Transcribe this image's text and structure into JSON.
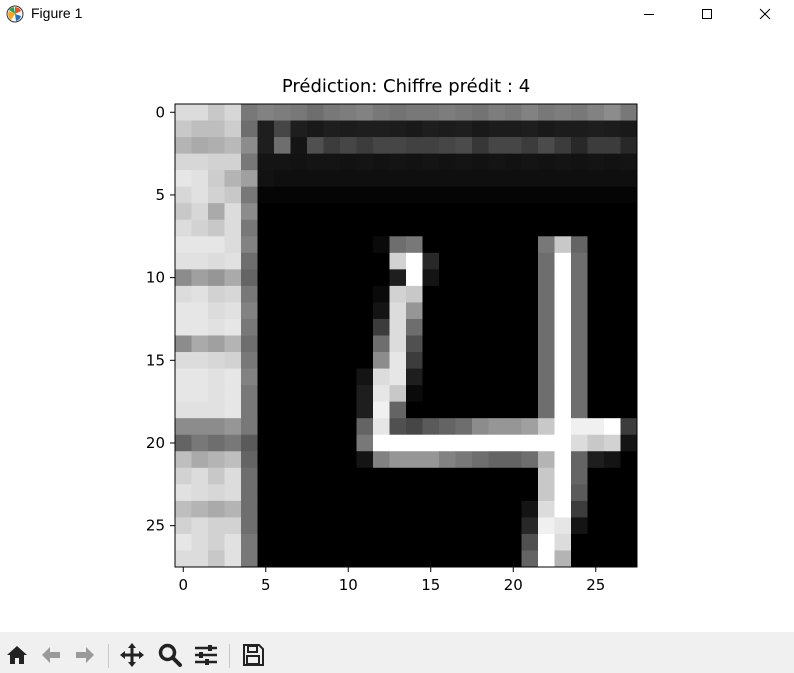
{
  "window": {
    "title": "Figure 1",
    "controls": [
      "minimize",
      "maximize",
      "close"
    ]
  },
  "toolbar": {
    "buttons": [
      "home-icon",
      "back-arrow-icon",
      "forward-arrow-icon",
      "pan-icon",
      "zoom-icon",
      "configure-subplots-icon",
      "save-icon"
    ]
  },
  "chart_data": {
    "type": "heatmap",
    "title": "Prédiction: Chiffre prédit : 4",
    "colormap": "gray",
    "xlabel": "",
    "ylabel": "",
    "xlim": [
      -0.5,
      27.5
    ],
    "ylim": [
      27.5,
      -0.5
    ],
    "xticks": [
      0,
      5,
      10,
      15,
      20,
      25
    ],
    "yticks": [
      0,
      5,
      10,
      15,
      20,
      25
    ],
    "grid": false,
    "shape": [
      28,
      28
    ],
    "values": [
      [
        220,
        220,
        200,
        215,
        120,
        130,
        125,
        120,
        110,
        120,
        125,
        130,
        120,
        115,
        120,
        120,
        125,
        120,
        115,
        125,
        120,
        130,
        120,
        125,
        120,
        130,
        140,
        120
      ],
      [
        200,
        190,
        190,
        205,
        110,
        30,
        70,
        30,
        25,
        30,
        28,
        30,
        30,
        28,
        25,
        30,
        28,
        30,
        25,
        28,
        28,
        30,
        25,
        28,
        28,
        30,
        28,
        25
      ],
      [
        180,
        170,
        175,
        185,
        140,
        30,
        110,
        20,
        80,
        60,
        70,
        60,
        70,
        70,
        65,
        65,
        70,
        75,
        55,
        70,
        70,
        60,
        75,
        60,
        40,
        60,
        60,
        40
      ],
      [
        215,
        215,
        210,
        210,
        120,
        20,
        20,
        18,
        20,
        20,
        18,
        20,
        18,
        20,
        18,
        20,
        18,
        20,
        18,
        20,
        18,
        20,
        18,
        20,
        18,
        20,
        18,
        20
      ],
      [
        230,
        225,
        205,
        180,
        160,
        18,
        15,
        15,
        15,
        15,
        15,
        15,
        15,
        15,
        15,
        15,
        15,
        15,
        15,
        15,
        15,
        15,
        15,
        15,
        15,
        15,
        15,
        15
      ],
      [
        215,
        225,
        210,
        200,
        120,
        5,
        5,
        5,
        5,
        5,
        5,
        5,
        5,
        5,
        5,
        5,
        5,
        5,
        5,
        5,
        5,
        5,
        5,
        5,
        5,
        5,
        5,
        5
      ],
      [
        200,
        215,
        170,
        220,
        140,
        0,
        0,
        0,
        0,
        0,
        0,
        0,
        0,
        0,
        0,
        0,
        0,
        0,
        0,
        0,
        0,
        0,
        0,
        0,
        0,
        0,
        0,
        0
      ],
      [
        220,
        210,
        200,
        220,
        120,
        0,
        0,
        0,
        0,
        0,
        0,
        0,
        0,
        0,
        0,
        0,
        0,
        0,
        0,
        0,
        0,
        0,
        0,
        0,
        0,
        0,
        0,
        0
      ],
      [
        230,
        230,
        230,
        220,
        130,
        0,
        0,
        0,
        0,
        0,
        0,
        0,
        10,
        110,
        120,
        0,
        0,
        0,
        0,
        0,
        0,
        0,
        120,
        200,
        100,
        0,
        0,
        0
      ],
      [
        225,
        225,
        220,
        225,
        110,
        0,
        0,
        0,
        0,
        0,
        0,
        0,
        0,
        210,
        255,
        40,
        0,
        0,
        0,
        0,
        0,
        0,
        110,
        255,
        110,
        0,
        0,
        0
      ],
      [
        140,
        160,
        150,
        170,
        100,
        0,
        0,
        0,
        0,
        0,
        0,
        0,
        0,
        30,
        255,
        20,
        0,
        0,
        0,
        0,
        0,
        0,
        110,
        255,
        110,
        0,
        0,
        0
      ],
      [
        220,
        225,
        210,
        215,
        120,
        0,
        0,
        0,
        0,
        0,
        0,
        0,
        10,
        210,
        200,
        0,
        0,
        0,
        0,
        0,
        0,
        0,
        110,
        255,
        110,
        0,
        0,
        0
      ],
      [
        230,
        230,
        220,
        225,
        130,
        0,
        0,
        0,
        0,
        0,
        0,
        0,
        20,
        220,
        150,
        0,
        0,
        0,
        0,
        0,
        0,
        0,
        110,
        255,
        110,
        0,
        0,
        0
      ],
      [
        230,
        230,
        225,
        230,
        120,
        0,
        0,
        0,
        0,
        0,
        0,
        0,
        60,
        220,
        110,
        0,
        0,
        0,
        0,
        0,
        0,
        0,
        110,
        255,
        110,
        0,
        0,
        0
      ],
      [
        140,
        170,
        160,
        180,
        110,
        0,
        0,
        0,
        0,
        0,
        0,
        0,
        110,
        220,
        80,
        0,
        0,
        0,
        0,
        0,
        0,
        0,
        110,
        255,
        110,
        0,
        0,
        0
      ],
      [
        220,
        220,
        215,
        210,
        120,
        0,
        0,
        0,
        0,
        0,
        0,
        0,
        140,
        230,
        60,
        0,
        0,
        0,
        0,
        0,
        0,
        0,
        110,
        255,
        110,
        0,
        0,
        0
      ],
      [
        230,
        230,
        225,
        230,
        130,
        0,
        0,
        0,
        0,
        0,
        0,
        20,
        220,
        230,
        30,
        0,
        0,
        0,
        0,
        0,
        0,
        0,
        110,
        255,
        110,
        0,
        0,
        0
      ],
      [
        230,
        230,
        225,
        230,
        120,
        0,
        0,
        0,
        0,
        0,
        0,
        30,
        230,
        200,
        10,
        0,
        0,
        0,
        0,
        0,
        0,
        0,
        110,
        255,
        110,
        0,
        0,
        0
      ],
      [
        225,
        225,
        225,
        230,
        120,
        0,
        0,
        0,
        0,
        0,
        0,
        30,
        240,
        100,
        0,
        0,
        0,
        0,
        0,
        0,
        0,
        0,
        110,
        255,
        110,
        0,
        0,
        0
      ],
      [
        140,
        140,
        140,
        150,
        120,
        0,
        0,
        0,
        0,
        0,
        0,
        100,
        230,
        80,
        70,
        90,
        100,
        110,
        140,
        150,
        150,
        160,
        200,
        255,
        240,
        240,
        255,
        60
      ],
      [
        100,
        120,
        110,
        120,
        90,
        0,
        0,
        0,
        0,
        0,
        0,
        120,
        255,
        255,
        255,
        255,
        255,
        255,
        255,
        255,
        255,
        255,
        255,
        255,
        220,
        200,
        210,
        20
      ],
      [
        190,
        170,
        180,
        190,
        100,
        0,
        0,
        0,
        0,
        0,
        0,
        20,
        130,
        150,
        150,
        150,
        130,
        120,
        110,
        100,
        100,
        110,
        180,
        255,
        100,
        30,
        20,
        0
      ],
      [
        210,
        220,
        200,
        220,
        110,
        0,
        0,
        0,
        0,
        0,
        0,
        0,
        0,
        0,
        0,
        0,
        0,
        0,
        0,
        0,
        0,
        0,
        200,
        255,
        100,
        0,
        0,
        0
      ],
      [
        225,
        220,
        215,
        220,
        110,
        0,
        0,
        0,
        0,
        0,
        0,
        0,
        0,
        0,
        0,
        0,
        0,
        0,
        0,
        0,
        0,
        0,
        200,
        255,
        90,
        0,
        0,
        0
      ],
      [
        190,
        180,
        170,
        180,
        110,
        0,
        0,
        0,
        0,
        0,
        0,
        0,
        0,
        0,
        0,
        0,
        0,
        0,
        0,
        0,
        0,
        20,
        220,
        255,
        60,
        0,
        0,
        0
      ],
      [
        210,
        220,
        210,
        210,
        110,
        0,
        0,
        0,
        0,
        0,
        0,
        0,
        0,
        0,
        0,
        0,
        0,
        0,
        0,
        0,
        0,
        40,
        240,
        230,
        20,
        0,
        0,
        0
      ],
      [
        230,
        220,
        210,
        225,
        120,
        0,
        0,
        0,
        0,
        0,
        0,
        0,
        0,
        0,
        0,
        0,
        0,
        0,
        0,
        0,
        0,
        80,
        255,
        220,
        0,
        0,
        0,
        0
      ],
      [
        220,
        220,
        200,
        225,
        120,
        0,
        0,
        0,
        0,
        0,
        0,
        0,
        0,
        0,
        0,
        0,
        0,
        0,
        0,
        0,
        0,
        100,
        255,
        180,
        0,
        0,
        0,
        0
      ]
    ]
  }
}
